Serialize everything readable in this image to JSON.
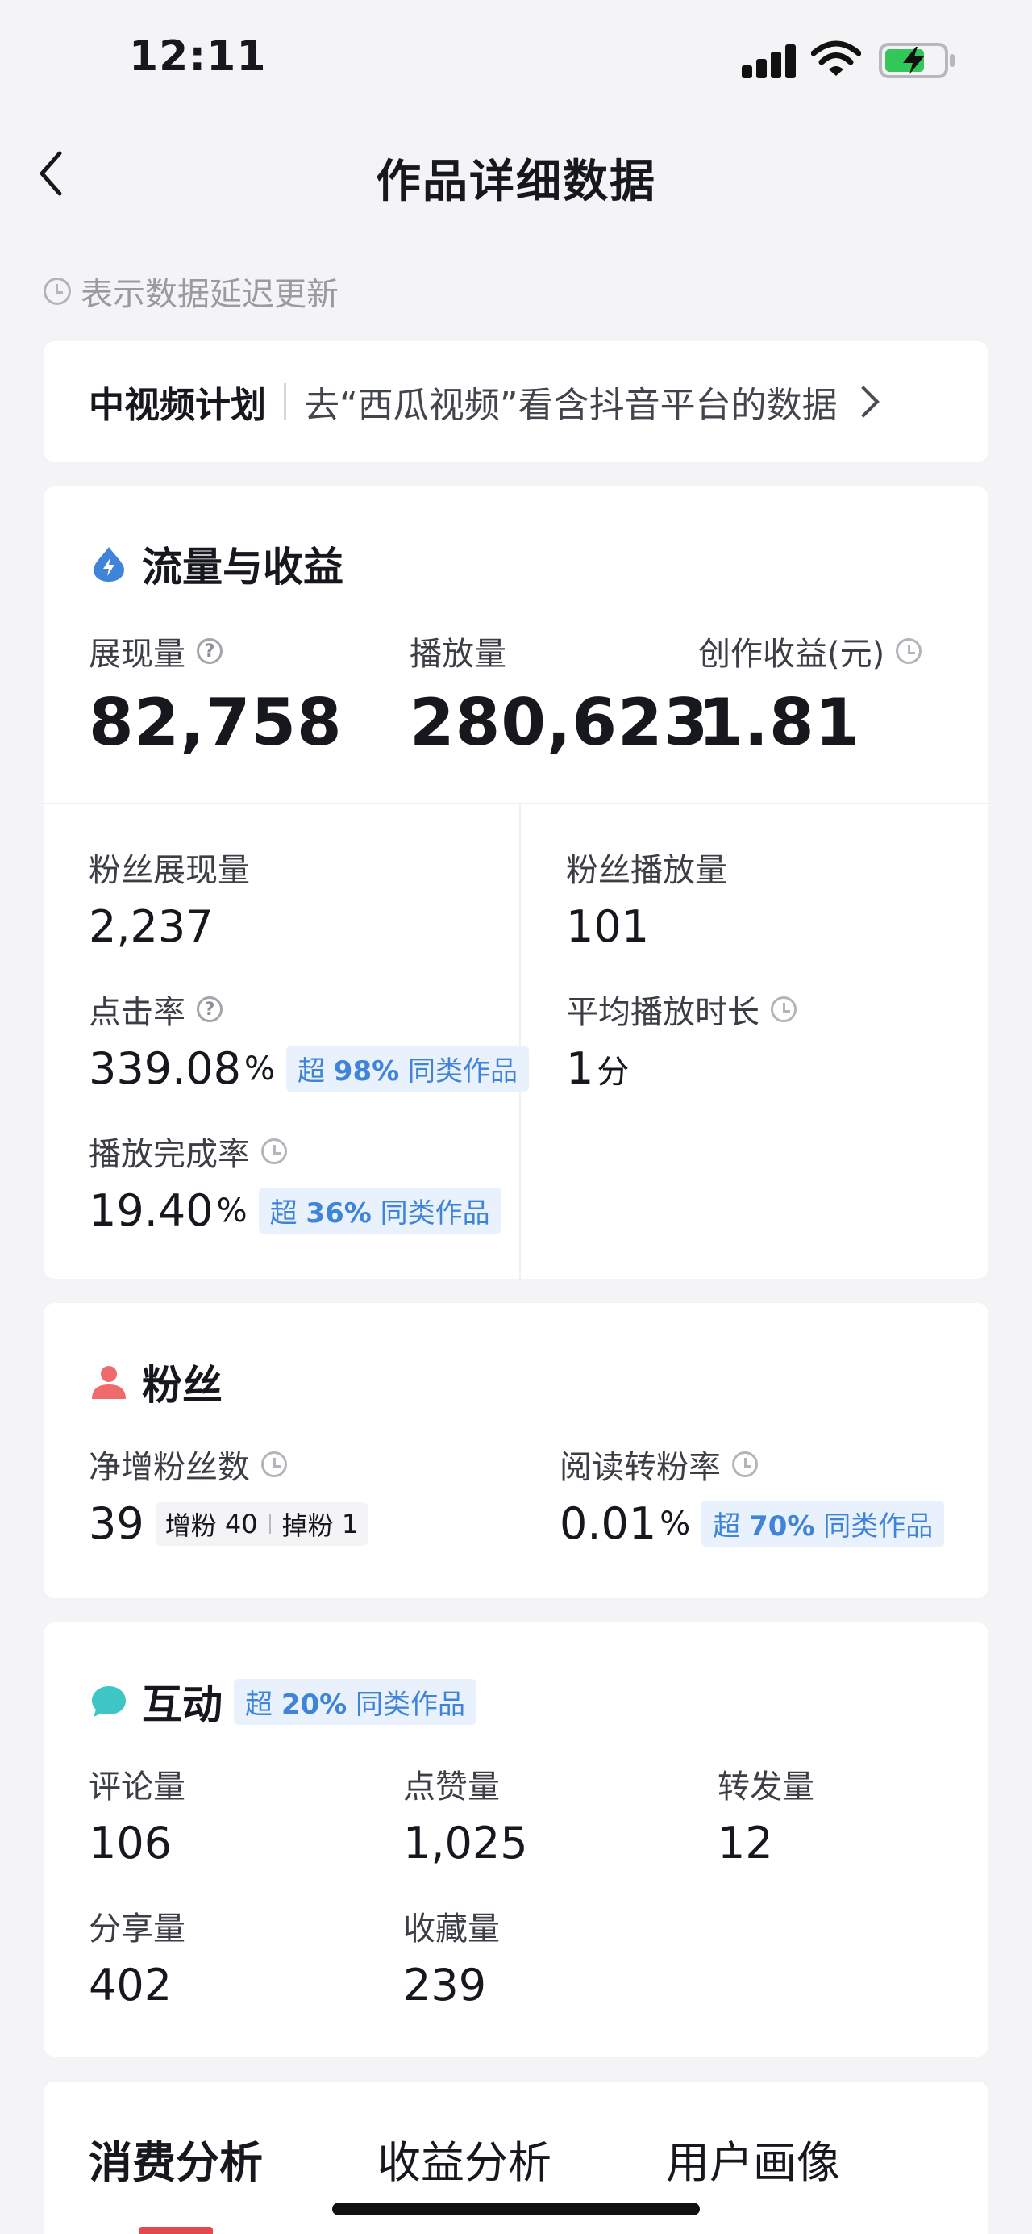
{
  "status_bar": {
    "time": "12:11"
  },
  "nav": {
    "title": "作品详细数据"
  },
  "delay_note": "表示数据延迟更新",
  "banner": {
    "title": "中视频计划",
    "text": "去“西瓜视频”看含抖音平台的数据"
  },
  "flow": {
    "title": "流量与收益",
    "impressions": {
      "label": "展现量",
      "value": "82,758"
    },
    "plays": {
      "label": "播放量",
      "value": "280,623"
    },
    "revenue": {
      "label": "创作收益(元)",
      "value": "1.81"
    },
    "fan_impressions": {
      "label": "粉丝展现量",
      "value": "2,237"
    },
    "fan_plays": {
      "label": "粉丝播放量",
      "value": "101"
    },
    "ctr": {
      "label": "点击率",
      "value": "339.08",
      "unit": "%",
      "badge_prefix": "超",
      "badge_pct": "98%",
      "badge_suffix": "同类作品"
    },
    "avg_duration": {
      "label": "平均播放时长",
      "value": "1",
      "unit": "分"
    },
    "completion": {
      "label": "播放完成率",
      "value": "19.40",
      "unit": "%",
      "badge_prefix": "超",
      "badge_pct": "36%",
      "badge_suffix": "同类作品"
    }
  },
  "fans": {
    "title": "粉丝",
    "net_gain": {
      "label": "净增粉丝数",
      "value": "39",
      "gain_label": "增粉",
      "gain": "40",
      "loss_label": "掉粉",
      "loss": "1"
    },
    "conversion": {
      "label": "阅读转粉率",
      "value": "0.01",
      "unit": "%",
      "badge_prefix": "超",
      "badge_pct": "70%",
      "badge_suffix": "同类作品"
    }
  },
  "interact": {
    "title": "互动",
    "badge_prefix": "超",
    "badge_pct": "20%",
    "badge_suffix": "同类作品",
    "comments": {
      "label": "评论量",
      "value": "106"
    },
    "likes": {
      "label": "点赞量",
      "value": "1,025"
    },
    "reposts": {
      "label": "转发量",
      "value": "12"
    },
    "shares": {
      "label": "分享量",
      "value": "402"
    },
    "favorites": {
      "label": "收藏量",
      "value": "239"
    }
  },
  "tabs": [
    "消费分析",
    "收益分析",
    "用户画像"
  ],
  "colors": {
    "accent_blue": "#3f84d8",
    "badge_bg": "#e8f1fc",
    "fans_red": "#ef6b6b",
    "interact_teal": "#3ec6c4",
    "tab_marker": "#e5474f"
  }
}
